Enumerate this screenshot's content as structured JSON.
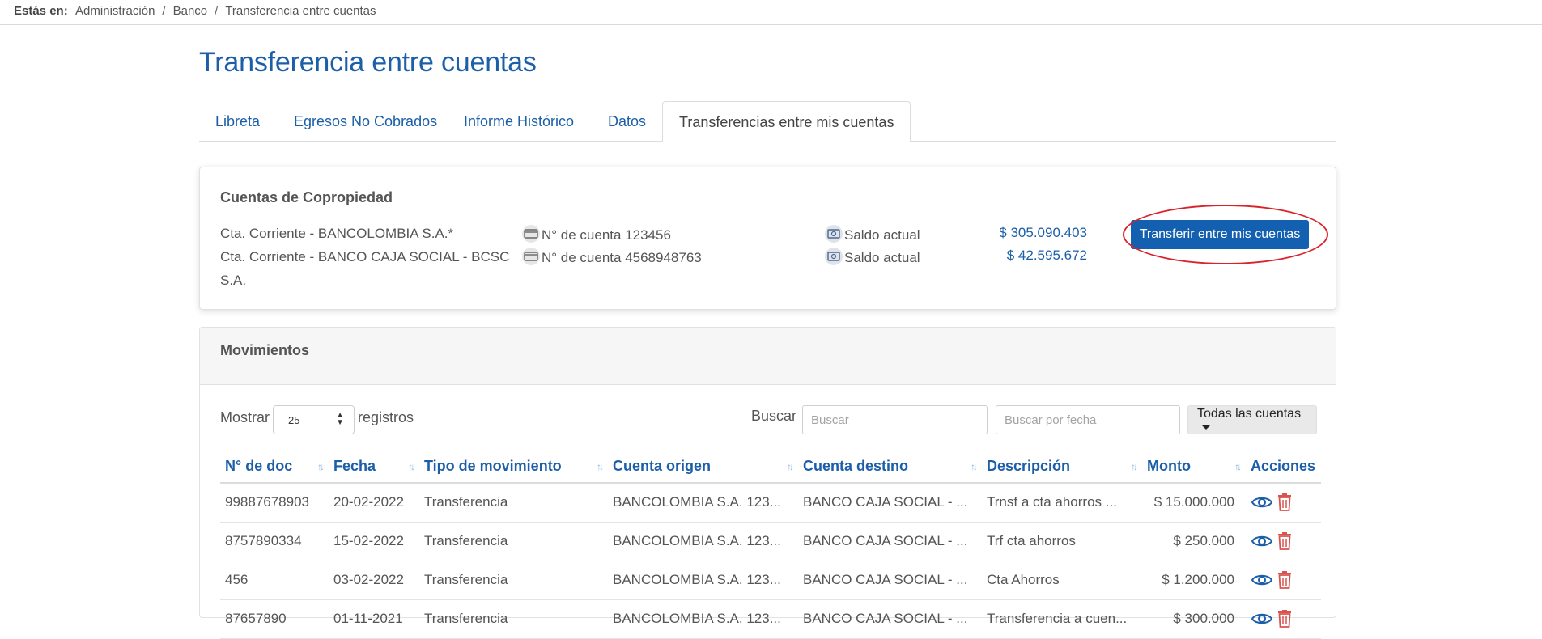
{
  "breadcrumb": {
    "lead": "Estás en:",
    "items": [
      "Administración",
      "Banco",
      "Transferencia entre cuentas"
    ]
  },
  "page_title": "Transferencia entre cuentas",
  "tabs": [
    {
      "label": "Libreta",
      "active": false
    },
    {
      "label": "Egresos No Cobrados",
      "active": false
    },
    {
      "label": "Informe Histórico",
      "active": false
    },
    {
      "label": "Datos",
      "active": false
    },
    {
      "label": "Transferencias entre mis cuentas",
      "active": true
    }
  ],
  "accounts_card": {
    "title": "Cuentas de Copropiedad",
    "accounts": [
      {
        "name": "Cta. Corriente - BANCOLOMBIA S.A.*",
        "number": "N° de cuenta 123456",
        "balance_label": "Saldo actual",
        "balance": "$ 305.090.403"
      },
      {
        "name": "Cta. Corriente - BANCO CAJA SOCIAL - BCSC S.A.",
        "number": "N° de cuenta 4568948763",
        "balance_label": "Saldo actual",
        "balance": "$ 42.595.672"
      }
    ],
    "transfer_button": "Transferir entre mis cuentas"
  },
  "movements": {
    "title": "Movimientos",
    "show_label": "Mostrar",
    "page_size": "25",
    "records_label": "registros",
    "search_label": "Buscar",
    "search_placeholder": "Buscar",
    "date_placeholder": "Buscar por fecha",
    "accounts_filter": "Todas las cuentas",
    "columns": [
      "N° de doc",
      "Fecha",
      "Tipo de movimiento",
      "Cuenta origen",
      "Cuenta destino",
      "Descripción",
      "Monto",
      "Acciones"
    ],
    "rows": [
      {
        "doc": "99887678903",
        "date": "20-02-2022",
        "type": "Transferencia",
        "origin": "BANCOLOMBIA S.A. 123...",
        "dest": "BANCO CAJA SOCIAL - ...",
        "desc": "Trnsf a cta ahorros ...",
        "amount": "$ 15.000.000"
      },
      {
        "doc": "8757890334",
        "date": "15-02-2022",
        "type": "Transferencia",
        "origin": "BANCOLOMBIA S.A. 123...",
        "dest": "BANCO CAJA SOCIAL - ...",
        "desc": "Trf cta ahorros",
        "amount": "$ 250.000"
      },
      {
        "doc": "456",
        "date": "03-02-2022",
        "type": "Transferencia",
        "origin": "BANCOLOMBIA S.A. 123...",
        "dest": "BANCO CAJA SOCIAL - ...",
        "desc": "Cta Ahorros",
        "amount": "$ 1.200.000"
      },
      {
        "doc": "87657890",
        "date": "01-11-2021",
        "type": "Transferencia",
        "origin": "BANCOLOMBIA S.A. 123...",
        "dest": "BANCO CAJA SOCIAL - ...",
        "desc": "Transferencia a cuen...",
        "amount": "$ 300.000"
      }
    ]
  },
  "colors": {
    "primary": "#1c5fa8",
    "button": "#1460b0",
    "highlight": "#d9232a",
    "danger": "#d9534f"
  }
}
